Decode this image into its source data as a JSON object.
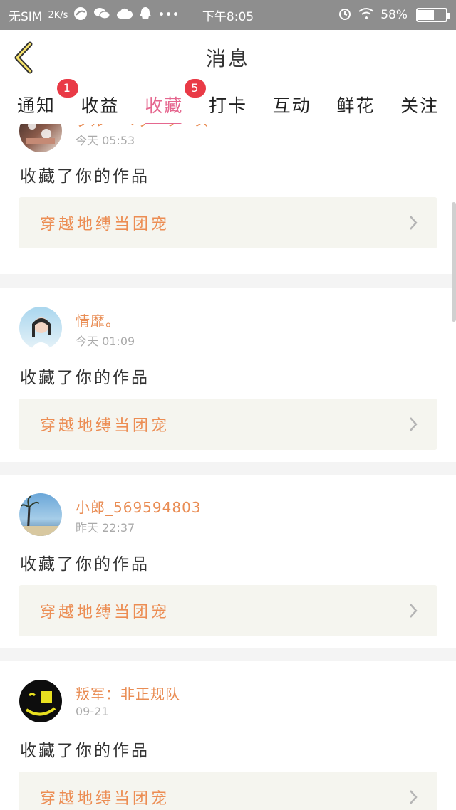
{
  "status_bar": {
    "carrier": "无SIM",
    "speed": "2K/s",
    "time": "下午8:05",
    "battery_percent": "58%",
    "battery_level": 0.58
  },
  "header": {
    "title": "消息"
  },
  "tabs": [
    {
      "label": "通知",
      "badge": "1"
    },
    {
      "label": "收益",
      "badge": ""
    },
    {
      "label": "收藏",
      "badge": "5",
      "active": true
    },
    {
      "label": "打卡",
      "badge": ""
    },
    {
      "label": "互动",
      "badge": ""
    },
    {
      "label": "鲜花",
      "badge": ""
    },
    {
      "label": "关注",
      "badge": ""
    }
  ],
  "feed": [
    {
      "user": "ブルーベリーソース",
      "time": "今天 05:53",
      "action": "收藏了你的作品",
      "work_title": "穿越地缚当团宠"
    },
    {
      "user": "情靡。",
      "time": "今天 01:09",
      "action": "收藏了你的作品",
      "work_title": "穿越地缚当团宠"
    },
    {
      "user": "小郎_569594803",
      "time": "昨天 22:37",
      "action": "收藏了你的作品",
      "work_title": "穿越地缚当团宠"
    },
    {
      "user": "叛军：非正规队",
      "time": "09-21",
      "action": "收藏了你的作品",
      "work_title": "穿越地缚当团宠"
    }
  ],
  "colors": {
    "accent_tab": "#e5678f",
    "badge": "#e93a46",
    "name": "#e98c53",
    "work_title": "#ec8d53"
  }
}
